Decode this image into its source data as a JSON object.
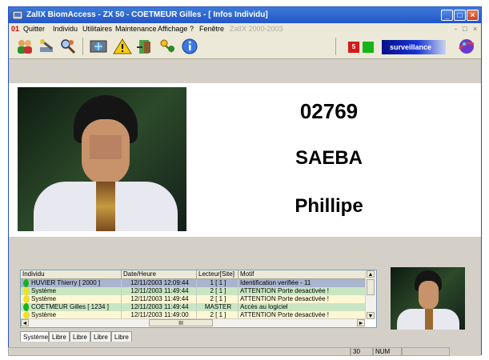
{
  "window": {
    "title": "ZalIX BiomAccess - ZX 50 - COETMEUR Gilles - [ Infos Individu]",
    "buttons": {
      "minimize": "_",
      "maximize": "□",
      "close": "×"
    }
  },
  "menu": {
    "doc_marker": "01",
    "items": [
      "Quitter",
      "Individu",
      "Utilitaires",
      "Maintenance",
      "Affichage",
      "?",
      "Fenêtre"
    ],
    "watermark": "ZalIX 2000-2003",
    "mdi_controls": [
      "-",
      "□",
      "×"
    ]
  },
  "toolbar": {
    "icons": [
      "users-icon",
      "tools-icon",
      "search-person-icon",
      "network-icon",
      "warning-icon",
      "door-icon",
      "keys-icon",
      "info-icon"
    ],
    "indicator_red_label": "5",
    "surveillance_label": "surveillance",
    "colors": {
      "red": "#d21c1c",
      "green": "#15b515"
    }
  },
  "identity": {
    "number": "02769",
    "lastname": "SAEBA",
    "firstname": "Phillipe"
  },
  "log": {
    "columns": [
      "Individu",
      "Date/Heure",
      "Lecteur[Site]",
      "Motif"
    ],
    "rows": [
      {
        "individu": "HUVIER Thierry [ 2000 ]",
        "date": "12/11/2003 12:09:44",
        "lecteur": "1 [ 1 ]",
        "motif": "Identification verifiée - 11",
        "dot": "#15b515",
        "bg": "#a9b4cf"
      },
      {
        "individu": "Système",
        "date": "12/11/2003 11:49:44",
        "lecteur": "2 [ 1 ]",
        "motif": "ATTENTION Porte desactivée !",
        "dot": "#f2e21a",
        "bg": "#c9e6c3"
      },
      {
        "individu": "Système",
        "date": "12/11/2003 11:49:44",
        "lecteur": "2 [ 1 ]",
        "motif": "ATTENTION Porte desactivée !",
        "dot": "#f2e21a",
        "bg": "#fdf7d4"
      },
      {
        "individu": "COETMEUR Gilles [ 1234 ]",
        "date": "12/11/2003 11:49:44",
        "lecteur": "MASTER",
        "motif": "Accès au logiciel",
        "dot": "#15b515",
        "bg": "#c9e6c3"
      },
      {
        "individu": "Système",
        "date": "12/11/2003 11:49:00",
        "lecteur": "2 [ 1 ]",
        "motif": "ATTENTION Porte desactivée !",
        "dot": "#f2e21a",
        "bg": "#fdf7d4"
      }
    ],
    "scroll": {
      "up": "▲",
      "down": "▼",
      "left": "◄",
      "right": "►",
      "hmid": "III"
    },
    "tabs": [
      "Système",
      "Libre",
      "Libre",
      "Libre",
      "Libre"
    ]
  },
  "status": {
    "count": "30",
    "num": "NUM"
  }
}
